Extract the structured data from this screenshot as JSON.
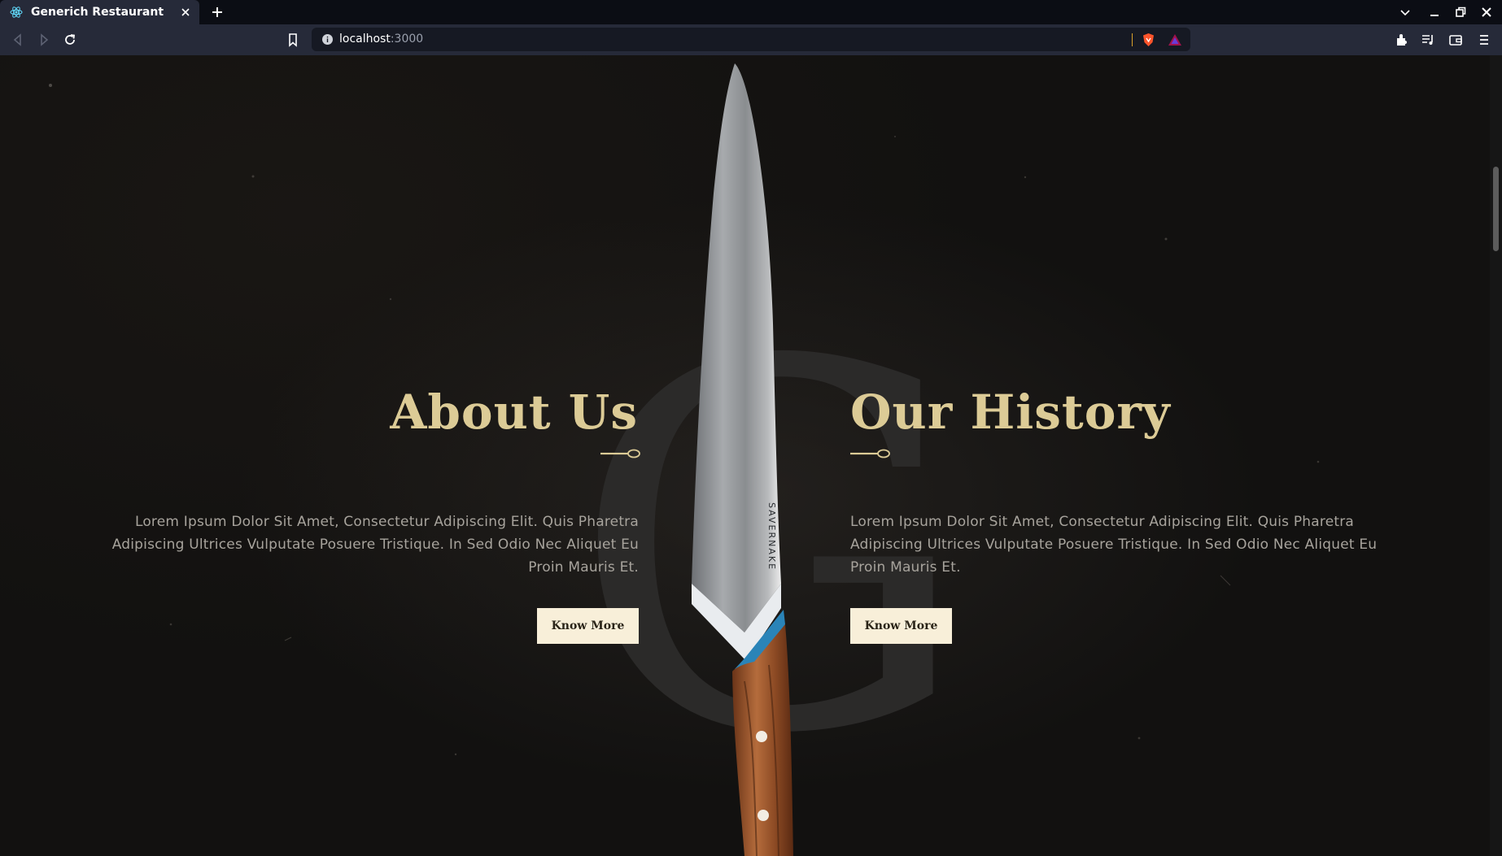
{
  "browser": {
    "tab": {
      "title": "Generich Restaurant"
    },
    "url": {
      "host": "localhost",
      "port": ":3000"
    },
    "icons": [
      "react-favicon",
      "close-icon",
      "plus-icon",
      "chevron-down-icon",
      "minimize-icon",
      "restore-icon",
      "close-window-icon",
      "back-icon",
      "forward-icon",
      "reload-icon",
      "bookmark-icon",
      "info-icon",
      "brave-shield-icon",
      "brave-rewards-icon",
      "extensions-icon",
      "media-icon",
      "wallet-icon",
      "menu-icon"
    ]
  },
  "page": {
    "watermark": "G",
    "about": {
      "title": "About Us",
      "text": "Lorem Ipsum Dolor Sit Amet, Consectetur Adipiscing Elit. Quis Pharetra Adipiscing Ultrices Vulputate Posuere Tristique. In Sed Odio Nec Aliquet Eu Proin Mauris Et.",
      "button": "Know More"
    },
    "history": {
      "title": "Our History",
      "text": "Lorem Ipsum Dolor Sit Amet, Consectetur Adipiscing Elit. Quis Pharetra Adipiscing Ultrices Vulputate Posuere Tristique. In Sed Odio Nec Aliquet Eu Proin Mauris Et.",
      "button": "Know More"
    },
    "knife_brand": "SAVERNAKE"
  },
  "colors": {
    "accent_gold": "#dccb96",
    "button_bg": "#f8efd9",
    "text_muted": "#a7a39c",
    "chrome_bg": "#262a39"
  }
}
